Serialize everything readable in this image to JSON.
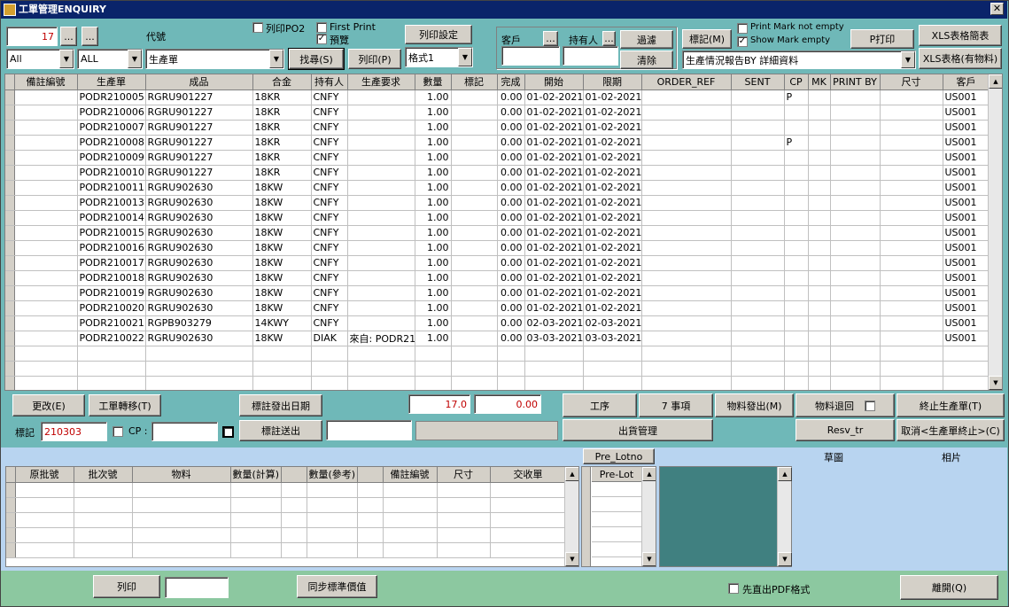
{
  "window": {
    "title": "工單管理ENQUIRY",
    "close": "✕"
  },
  "top": {
    "count_value": "17",
    "btn_dots1": "...",
    "btn_dots2": "...",
    "code_label": "代號",
    "print_po2_label": "列印PO2",
    "first_print_label": "First Print",
    "preview_label": "預覽",
    "col_setting": "列印設定",
    "customer_label": "客戶",
    "customer_dots": "...",
    "holder_label": "持有人",
    "holder_dots": "...",
    "filter_btn": "過濾",
    "clear_btn": "清除",
    "mark_btn": "標記(M)",
    "print_mark_not_empty": "Print Mark not empty",
    "show_mark_empty": "Show Mark empty",
    "p_print": "P打印",
    "xls_simple": "XLS表格簡表",
    "xls_material": "XLS表格(有物料)",
    "combo1": "All",
    "combo2": "ALL",
    "combo3": "生產單",
    "search_btn": "找尋(S)",
    "print_btn": "列印(P)",
    "format_combo": "格式1",
    "report_combo": "生產情況報告BY 詳細資料"
  },
  "grid": {
    "headers": [
      "備註編號",
      "生產單",
      "成品",
      "合金",
      "持有人",
      "生產要求",
      "數量",
      "標記",
      "完成",
      "開始",
      "限期",
      "ORDER_REF",
      "SENT",
      "CP",
      "MK",
      "PRINT BY",
      "尺寸",
      "客戶"
    ],
    "rows": [
      [
        "",
        "PODR210005",
        "RGRU901227",
        "18KR",
        "CNFY",
        "",
        "1.00",
        "",
        "0.00",
        "01-02-2021",
        "01-02-2021",
        "",
        "",
        "P",
        "",
        "",
        "",
        "US001"
      ],
      [
        "",
        "PODR210006",
        "RGRU901227",
        "18KR",
        "CNFY",
        "",
        "1.00",
        "",
        "0.00",
        "01-02-2021",
        "01-02-2021",
        "",
        "",
        "",
        "",
        "",
        "",
        "US001"
      ],
      [
        "",
        "PODR210007",
        "RGRU901227",
        "18KR",
        "CNFY",
        "",
        "1.00",
        "",
        "0.00",
        "01-02-2021",
        "01-02-2021",
        "",
        "",
        "",
        "",
        "",
        "",
        "US001"
      ],
      [
        "",
        "PODR210008",
        "RGRU901227",
        "18KR",
        "CNFY",
        "",
        "1.00",
        "",
        "0.00",
        "01-02-2021",
        "01-02-2021",
        "",
        "",
        "P",
        "",
        "",
        "",
        "US001"
      ],
      [
        "",
        "PODR210009",
        "RGRU901227",
        "18KR",
        "CNFY",
        "",
        "1.00",
        "",
        "0.00",
        "01-02-2021",
        "01-02-2021",
        "",
        "",
        "",
        "",
        "",
        "",
        "US001"
      ],
      [
        "",
        "PODR210010",
        "RGRU901227",
        "18KR",
        "CNFY",
        "",
        "1.00",
        "",
        "0.00",
        "01-02-2021",
        "01-02-2021",
        "",
        "",
        "",
        "",
        "",
        "",
        "US001"
      ],
      [
        "",
        "PODR210011",
        "RGRU902630",
        "18KW",
        "CNFY",
        "",
        "1.00",
        "",
        "0.00",
        "01-02-2021",
        "01-02-2021",
        "",
        "",
        "",
        "",
        "",
        "",
        "US001"
      ],
      [
        "",
        "PODR210013",
        "RGRU902630",
        "18KW",
        "CNFY",
        "",
        "1.00",
        "",
        "0.00",
        "01-02-2021",
        "01-02-2021",
        "",
        "",
        "",
        "",
        "",
        "",
        "US001"
      ],
      [
        "",
        "PODR210014",
        "RGRU902630",
        "18KW",
        "CNFY",
        "",
        "1.00",
        "",
        "0.00",
        "01-02-2021",
        "01-02-2021",
        "",
        "",
        "",
        "",
        "",
        "",
        "US001"
      ],
      [
        "",
        "PODR210015",
        "RGRU902630",
        "18KW",
        "CNFY",
        "",
        "1.00",
        "",
        "0.00",
        "01-02-2021",
        "01-02-2021",
        "",
        "",
        "",
        "",
        "",
        "",
        "US001"
      ],
      [
        "",
        "PODR210016",
        "RGRU902630",
        "18KW",
        "CNFY",
        "",
        "1.00",
        "",
        "0.00",
        "01-02-2021",
        "01-02-2021",
        "",
        "",
        "",
        "",
        "",
        "",
        "US001"
      ],
      [
        "",
        "PODR210017",
        "RGRU902630",
        "18KW",
        "CNFY",
        "",
        "1.00",
        "",
        "0.00",
        "01-02-2021",
        "01-02-2021",
        "",
        "",
        "",
        "",
        "",
        "",
        "US001"
      ],
      [
        "",
        "PODR210018",
        "RGRU902630",
        "18KW",
        "CNFY",
        "",
        "1.00",
        "",
        "0.00",
        "01-02-2021",
        "01-02-2021",
        "",
        "",
        "",
        "",
        "",
        "",
        "US001"
      ],
      [
        "",
        "PODR210019",
        "RGRU902630",
        "18KW",
        "CNFY",
        "",
        "1.00",
        "",
        "0.00",
        "01-02-2021",
        "01-02-2021",
        "",
        "",
        "",
        "",
        "",
        "",
        "US001"
      ],
      [
        "",
        "PODR210020",
        "RGRU902630",
        "18KW",
        "CNFY",
        "",
        "1.00",
        "",
        "0.00",
        "01-02-2021",
        "01-02-2021",
        "",
        "",
        "",
        "",
        "",
        "",
        "US001"
      ],
      [
        "",
        "PODR210021",
        "RGPB903279",
        "14KWY",
        "CNFY",
        "",
        "1.00",
        "",
        "0.00",
        "02-03-2021",
        "02-03-2021",
        "",
        "",
        "",
        "",
        "",
        "",
        "US001"
      ],
      [
        "",
        "PODR210022",
        "RGRU902630",
        "18KW",
        "DIAK",
        "來自: PODR21",
        "1.00",
        "",
        "0.00",
        "03-03-2021",
        "03-03-2021",
        "",
        "",
        "",
        "",
        "",
        "",
        "US001"
      ]
    ]
  },
  "mid": {
    "modify": "更改(E)",
    "transfer": "工單轉移(T)",
    "mark_date": "標註發出日期",
    "total1": "17.0",
    "total2": "0.00",
    "process": "工序",
    "matters": "7 事項",
    "mat_issue": "物料發出(M)",
    "mat_return": "物料退回",
    "stop_order": "終止生產單(T)",
    "mark_label": "標記",
    "mark_value": "210303",
    "cp_label": "CP :",
    "mark_send": "標註送出",
    "ship_mgmt": "出貨管理",
    "resv": "Resv_tr",
    "cancel_stop": "取消<生產單終止>(C)"
  },
  "lower": {
    "headers": [
      "原批號",
      "批次號",
      "物料",
      "數量(計算)",
      "",
      "數量(參考)",
      "",
      "備註編號",
      "尺寸",
      "交收單"
    ],
    "pre_lotno": "Pre_Lotno",
    "pre_lot": "Pre-Lot",
    "sketch_label": "草圖",
    "photo_label": "相片"
  },
  "footer": {
    "print": "列印",
    "sync": "同步標準價值",
    "pdf_label": "先直出PDF格式",
    "leave": "離開(Q)"
  }
}
